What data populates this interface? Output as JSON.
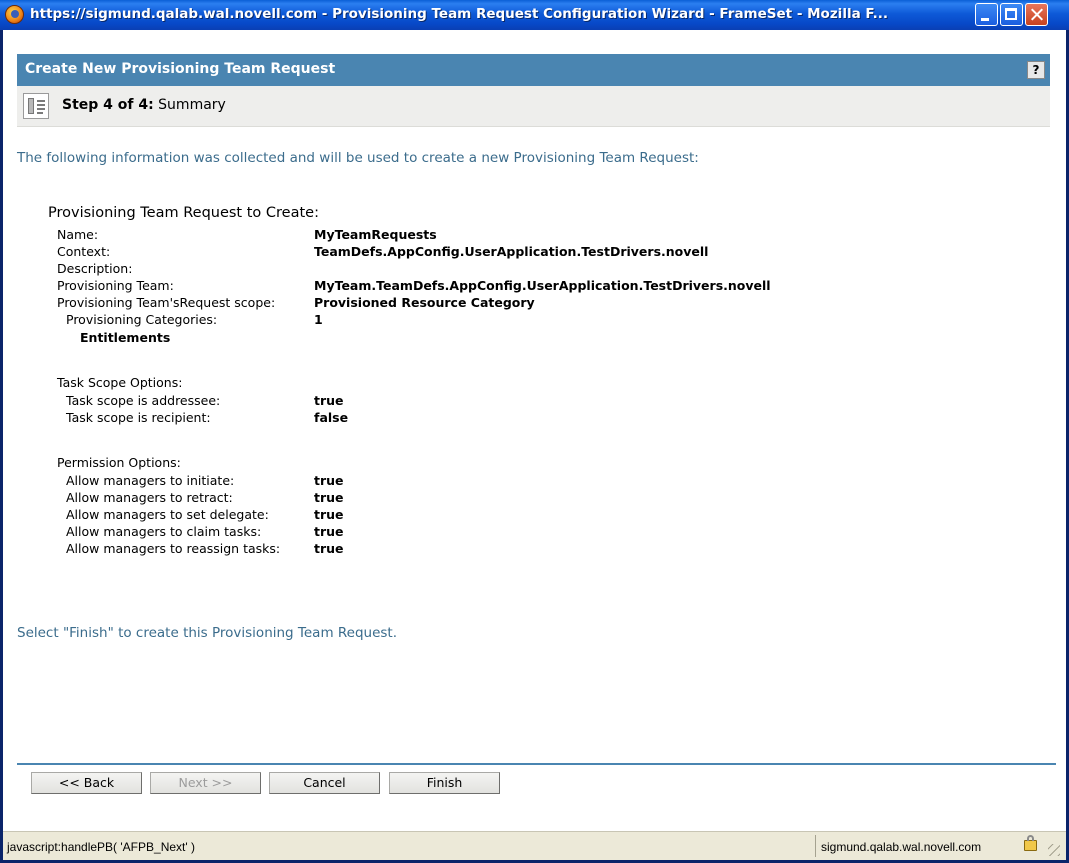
{
  "window": {
    "title": "https://sigmund.qalab.wal.novell.com - Provisioning Team Request Configuration Wizard - FrameSet - Mozilla F..."
  },
  "header": {
    "title": "Create New Provisioning Team Request",
    "help": "?"
  },
  "step": {
    "prefix": "Step 4 of 4:",
    "name": "Summary"
  },
  "intro": "The following information was collected and will be used to create a new Provisioning Team Request:",
  "summary": {
    "title": "Provisioning Team Request to Create:",
    "name_label": "Name:",
    "name_value": "MyTeamRequests",
    "context_label": "Context:",
    "context_value": "TeamDefs.AppConfig.UserApplication.TestDrivers.novell",
    "description_label": "Description:",
    "team_label": "Provisioning Team:",
    "team_value": "MyTeam.TeamDefs.AppConfig.UserApplication.TestDrivers.novell",
    "scope_label": "Provisioning Team'sRequest scope:",
    "scope_value": "Provisioned Resource Category",
    "categories_label": "Provisioning Categories:",
    "categories_value": "1",
    "category_item": "Entitlements"
  },
  "task_scope": {
    "title": "Task Scope Options:",
    "addressee_label": "Task scope is addressee:",
    "addressee_value": "true",
    "recipient_label": "Task scope is recipient:",
    "recipient_value": "false"
  },
  "permissions": {
    "title": "Permission Options:",
    "items": [
      {
        "label": "Allow managers to initiate:",
        "value": "true"
      },
      {
        "label": "Allow managers to retract:",
        "value": "true"
      },
      {
        "label": "Allow managers to set delegate:",
        "value": "true"
      },
      {
        "label": "Allow managers to claim tasks:",
        "value": "true"
      },
      {
        "label": "Allow managers to reassign tasks:",
        "value": "true"
      }
    ]
  },
  "finish_note": "Select \"Finish\" to create this Provisioning Team Request.",
  "buttons": {
    "back": "<< Back",
    "next": "Next >>",
    "cancel": "Cancel",
    "finish": "Finish"
  },
  "statusbar": {
    "text": "javascript:handlePB( 'AFPB_Next' )",
    "host": "sigmund.qalab.wal.novell.com"
  }
}
